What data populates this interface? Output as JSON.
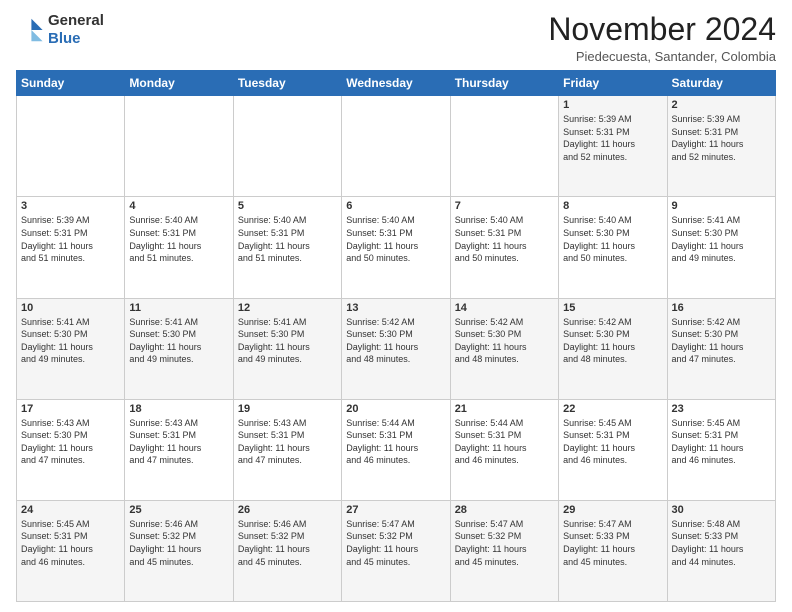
{
  "logo": {
    "general": "General",
    "blue": "Blue"
  },
  "header": {
    "month": "November 2024",
    "location": "Piedecuesta, Santander, Colombia"
  },
  "days_of_week": [
    "Sunday",
    "Monday",
    "Tuesday",
    "Wednesday",
    "Thursday",
    "Friday",
    "Saturday"
  ],
  "weeks": [
    [
      {
        "day": "",
        "text": ""
      },
      {
        "day": "",
        "text": ""
      },
      {
        "day": "",
        "text": ""
      },
      {
        "day": "",
        "text": ""
      },
      {
        "day": "",
        "text": ""
      },
      {
        "day": "1",
        "text": "Sunrise: 5:39 AM\nSunset: 5:31 PM\nDaylight: 11 hours\nand 52 minutes."
      },
      {
        "day": "2",
        "text": "Sunrise: 5:39 AM\nSunset: 5:31 PM\nDaylight: 11 hours\nand 52 minutes."
      }
    ],
    [
      {
        "day": "3",
        "text": "Sunrise: 5:39 AM\nSunset: 5:31 PM\nDaylight: 11 hours\nand 51 minutes."
      },
      {
        "day": "4",
        "text": "Sunrise: 5:40 AM\nSunset: 5:31 PM\nDaylight: 11 hours\nand 51 minutes."
      },
      {
        "day": "5",
        "text": "Sunrise: 5:40 AM\nSunset: 5:31 PM\nDaylight: 11 hours\nand 51 minutes."
      },
      {
        "day": "6",
        "text": "Sunrise: 5:40 AM\nSunset: 5:31 PM\nDaylight: 11 hours\nand 50 minutes."
      },
      {
        "day": "7",
        "text": "Sunrise: 5:40 AM\nSunset: 5:31 PM\nDaylight: 11 hours\nand 50 minutes."
      },
      {
        "day": "8",
        "text": "Sunrise: 5:40 AM\nSunset: 5:30 PM\nDaylight: 11 hours\nand 50 minutes."
      },
      {
        "day": "9",
        "text": "Sunrise: 5:41 AM\nSunset: 5:30 PM\nDaylight: 11 hours\nand 49 minutes."
      }
    ],
    [
      {
        "day": "10",
        "text": "Sunrise: 5:41 AM\nSunset: 5:30 PM\nDaylight: 11 hours\nand 49 minutes."
      },
      {
        "day": "11",
        "text": "Sunrise: 5:41 AM\nSunset: 5:30 PM\nDaylight: 11 hours\nand 49 minutes."
      },
      {
        "day": "12",
        "text": "Sunrise: 5:41 AM\nSunset: 5:30 PM\nDaylight: 11 hours\nand 49 minutes."
      },
      {
        "day": "13",
        "text": "Sunrise: 5:42 AM\nSunset: 5:30 PM\nDaylight: 11 hours\nand 48 minutes."
      },
      {
        "day": "14",
        "text": "Sunrise: 5:42 AM\nSunset: 5:30 PM\nDaylight: 11 hours\nand 48 minutes."
      },
      {
        "day": "15",
        "text": "Sunrise: 5:42 AM\nSunset: 5:30 PM\nDaylight: 11 hours\nand 48 minutes."
      },
      {
        "day": "16",
        "text": "Sunrise: 5:42 AM\nSunset: 5:30 PM\nDaylight: 11 hours\nand 47 minutes."
      }
    ],
    [
      {
        "day": "17",
        "text": "Sunrise: 5:43 AM\nSunset: 5:30 PM\nDaylight: 11 hours\nand 47 minutes."
      },
      {
        "day": "18",
        "text": "Sunrise: 5:43 AM\nSunset: 5:31 PM\nDaylight: 11 hours\nand 47 minutes."
      },
      {
        "day": "19",
        "text": "Sunrise: 5:43 AM\nSunset: 5:31 PM\nDaylight: 11 hours\nand 47 minutes."
      },
      {
        "day": "20",
        "text": "Sunrise: 5:44 AM\nSunset: 5:31 PM\nDaylight: 11 hours\nand 46 minutes."
      },
      {
        "day": "21",
        "text": "Sunrise: 5:44 AM\nSunset: 5:31 PM\nDaylight: 11 hours\nand 46 minutes."
      },
      {
        "day": "22",
        "text": "Sunrise: 5:45 AM\nSunset: 5:31 PM\nDaylight: 11 hours\nand 46 minutes."
      },
      {
        "day": "23",
        "text": "Sunrise: 5:45 AM\nSunset: 5:31 PM\nDaylight: 11 hours\nand 46 minutes."
      }
    ],
    [
      {
        "day": "24",
        "text": "Sunrise: 5:45 AM\nSunset: 5:31 PM\nDaylight: 11 hours\nand 46 minutes."
      },
      {
        "day": "25",
        "text": "Sunrise: 5:46 AM\nSunset: 5:32 PM\nDaylight: 11 hours\nand 45 minutes."
      },
      {
        "day": "26",
        "text": "Sunrise: 5:46 AM\nSunset: 5:32 PM\nDaylight: 11 hours\nand 45 minutes."
      },
      {
        "day": "27",
        "text": "Sunrise: 5:47 AM\nSunset: 5:32 PM\nDaylight: 11 hours\nand 45 minutes."
      },
      {
        "day": "28",
        "text": "Sunrise: 5:47 AM\nSunset: 5:32 PM\nDaylight: 11 hours\nand 45 minutes."
      },
      {
        "day": "29",
        "text": "Sunrise: 5:47 AM\nSunset: 5:33 PM\nDaylight: 11 hours\nand 45 minutes."
      },
      {
        "day": "30",
        "text": "Sunrise: 5:48 AM\nSunset: 5:33 PM\nDaylight: 11 hours\nand 44 minutes."
      }
    ]
  ]
}
